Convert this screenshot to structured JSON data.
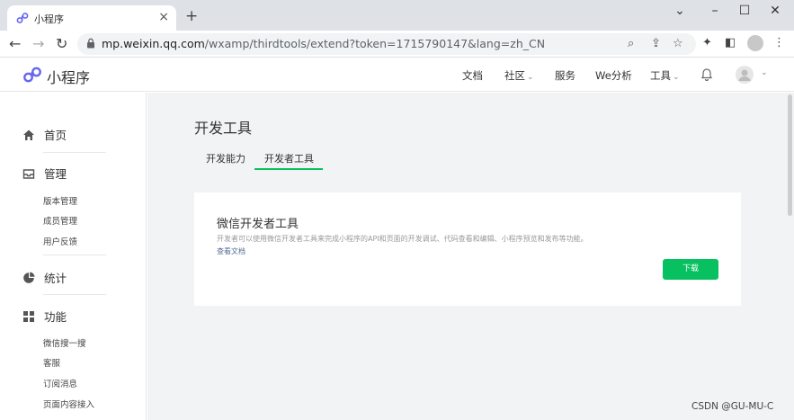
{
  "browser": {
    "tab_title": "小程序",
    "tab_close": "×",
    "new_tab": "+",
    "window_controls": [
      "⌄",
      "–",
      "☐",
      "✕"
    ],
    "url_host": "mp.weixin.qq.com",
    "url_rest": "/wxamp/thirdtools/extend?token=1715790147&lang=zh_CN",
    "icons": [
      "back-icon",
      "forward-icon",
      "reload-icon",
      "lock-icon",
      "zoom-icon",
      "share-icon",
      "star-icon",
      "extensions-icon",
      "sidepanel-icon",
      "profile-icon",
      "menu-icon"
    ]
  },
  "site": {
    "brand": "小程序",
    "nav": [
      "文档",
      "社区",
      "服务",
      "We分析",
      "工具"
    ],
    "nav_caret": "⌄",
    "accent": "#07c160"
  },
  "sidebar": {
    "groups": [
      {
        "label": "首页",
        "icon": "home-icon",
        "items": []
      },
      {
        "label": "管理",
        "icon": "inbox-icon",
        "items": [
          "版本管理",
          "成员管理",
          "用户反馈"
        ]
      },
      {
        "label": "统计",
        "icon": "pie-chart-icon",
        "items": []
      },
      {
        "label": "功能",
        "icon": "grid-icon",
        "items": [
          "微信搜一搜",
          "客服",
          "订阅消息",
          "页面内容接入"
        ]
      }
    ]
  },
  "main": {
    "title": "开发工具",
    "tabs": [
      "开发能力",
      "开发者工具"
    ],
    "active_tab": "开发者工具",
    "card": {
      "title": "微信开发者工具",
      "desc": "开发者可以使用微信开发者工具来完成小程序的API和页面的开发调试、代码查看和编辑、小程序预览和发布等功能。",
      "link": "查看文档",
      "button": "下载"
    }
  },
  "watermark": "CSDN @GU-MU-C"
}
